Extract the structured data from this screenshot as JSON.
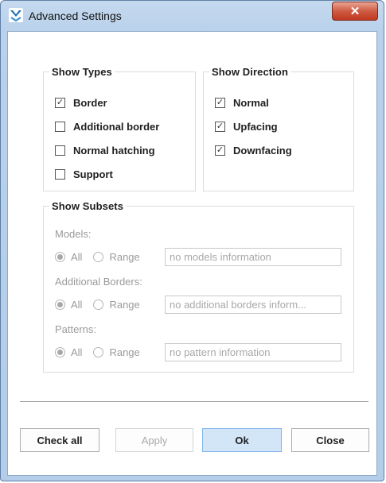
{
  "window": {
    "title": "Advanced Settings",
    "close_glyph": "✕"
  },
  "show_types": {
    "legend": "Show Types",
    "items": [
      {
        "label": "Border",
        "checked": true
      },
      {
        "label": "Additional border",
        "checked": false
      },
      {
        "label": "Normal hatching",
        "checked": false
      },
      {
        "label": "Support",
        "checked": false
      }
    ]
  },
  "show_direction": {
    "legend": "Show Direction",
    "items": [
      {
        "label": "Normal",
        "checked": true
      },
      {
        "label": "Upfacing",
        "checked": true
      },
      {
        "label": "Downfacing",
        "checked": true
      }
    ]
  },
  "show_subsets": {
    "legend": "Show Subsets",
    "groups": [
      {
        "label": "Models:",
        "all": "All",
        "range": "Range",
        "selected": "all",
        "field": "no models information"
      },
      {
        "label": "Additional Borders:",
        "all": "All",
        "range": "Range",
        "selected": "all",
        "field": "no additional borders inform..."
      },
      {
        "label": "Patterns:",
        "all": "All",
        "range": "Range",
        "selected": "all",
        "field": "no pattern information"
      }
    ]
  },
  "buttons": {
    "check_all": "Check all",
    "apply": "Apply",
    "ok": "Ok",
    "close": "Close"
  },
  "check_glyph": "✓",
  "colors": {
    "title_bar": "#b9d1ea",
    "close_button": "#c9452d",
    "ok_button": "#d2e6f7",
    "disabled_text": "#9a9a9a"
  }
}
